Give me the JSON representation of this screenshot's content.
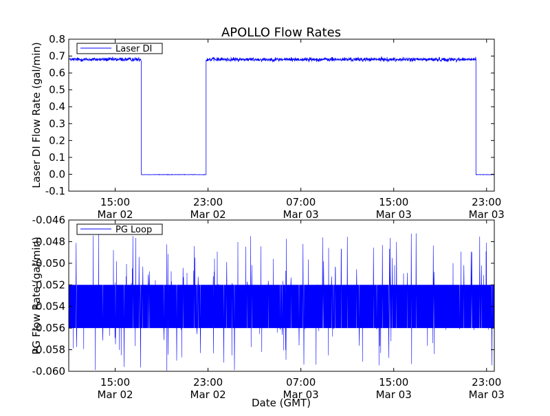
{
  "figure": {
    "title": "APOLLO Flow Rates",
    "xlabel": "Date (GMT)"
  },
  "chart_data": [
    {
      "type": "line",
      "title": "APOLLO Flow Rates",
      "xlabel": "",
      "ylabel": "Laser DI Flow Rate (gal/min)",
      "xlim": [
        "2014-03-02 11:00",
        "2014-03-03 23:40"
      ],
      "ylim": [
        -0.1,
        0.8
      ],
      "y_ticks": [
        -0.1,
        0.0,
        0.1,
        0.2,
        0.3,
        0.4,
        0.5,
        0.6,
        0.7,
        0.8
      ],
      "y_tick_labels": [
        "-0.1",
        "0.0",
        "0.1",
        "0.2",
        "0.3",
        "0.4",
        "0.5",
        "0.6",
        "0.7",
        "0.8"
      ],
      "x_ticks": [
        {
          "time": "15:00",
          "date": "Mar 02"
        },
        {
          "time": "23:00",
          "date": "Mar 02"
        },
        {
          "time": "07:00",
          "date": "Mar 03"
        },
        {
          "time": "15:00",
          "date": "Mar 03"
        },
        {
          "time": "23:00",
          "date": "Mar 03"
        }
      ],
      "grid": false,
      "legend_position": "top-left",
      "color": "#0000ff",
      "series": [
        {
          "name": "Laser DI",
          "segments": [
            {
              "start": "2014-03-02 11:00",
              "end": "2014-03-02 17:15",
              "mean": 0.68,
              "noise": 0.018
            },
            {
              "start": "2014-03-02 17:15",
              "end": "2014-03-02 22:50",
              "mean": -0.002,
              "noise": 0.002
            },
            {
              "start": "2014-03-02 22:50",
              "end": "2014-03-03 22:05",
              "mean": 0.68,
              "noise": 0.018
            },
            {
              "start": "2014-03-03 22:05",
              "end": "2014-03-03 23:40",
              "mean": -0.002,
              "noise": 0.002
            }
          ]
        }
      ]
    },
    {
      "type": "line",
      "title": "",
      "xlabel": "Date (GMT)",
      "ylabel": "PG Flow Rate (gal/min)",
      "xlim": [
        "2014-03-02 11:00",
        "2014-03-03 23:40"
      ],
      "ylim": [
        -0.06,
        -0.046
      ],
      "y_ticks": [
        -0.06,
        -0.058,
        -0.056,
        -0.054,
        -0.052,
        -0.05,
        -0.048,
        -0.046
      ],
      "y_tick_labels": [
        "-0.060",
        "-0.058",
        "-0.056",
        "-0.054",
        "-0.052",
        "-0.050",
        "-0.048",
        "-0.046"
      ],
      "x_ticks": [
        {
          "time": "15:00",
          "date": "Mar 02"
        },
        {
          "time": "23:00",
          "date": "Mar 02"
        },
        {
          "time": "07:00",
          "date": "Mar 03"
        },
        {
          "time": "15:00",
          "date": "Mar 03"
        },
        {
          "time": "23:00",
          "date": "Mar 03"
        }
      ],
      "grid": false,
      "legend_position": "top-left",
      "color": "#0000ff",
      "series": [
        {
          "name": "PG Loop",
          "band": [
            -0.056,
            -0.052
          ],
          "spike_range": [
            -0.06,
            -0.0472
          ]
        }
      ]
    }
  ]
}
